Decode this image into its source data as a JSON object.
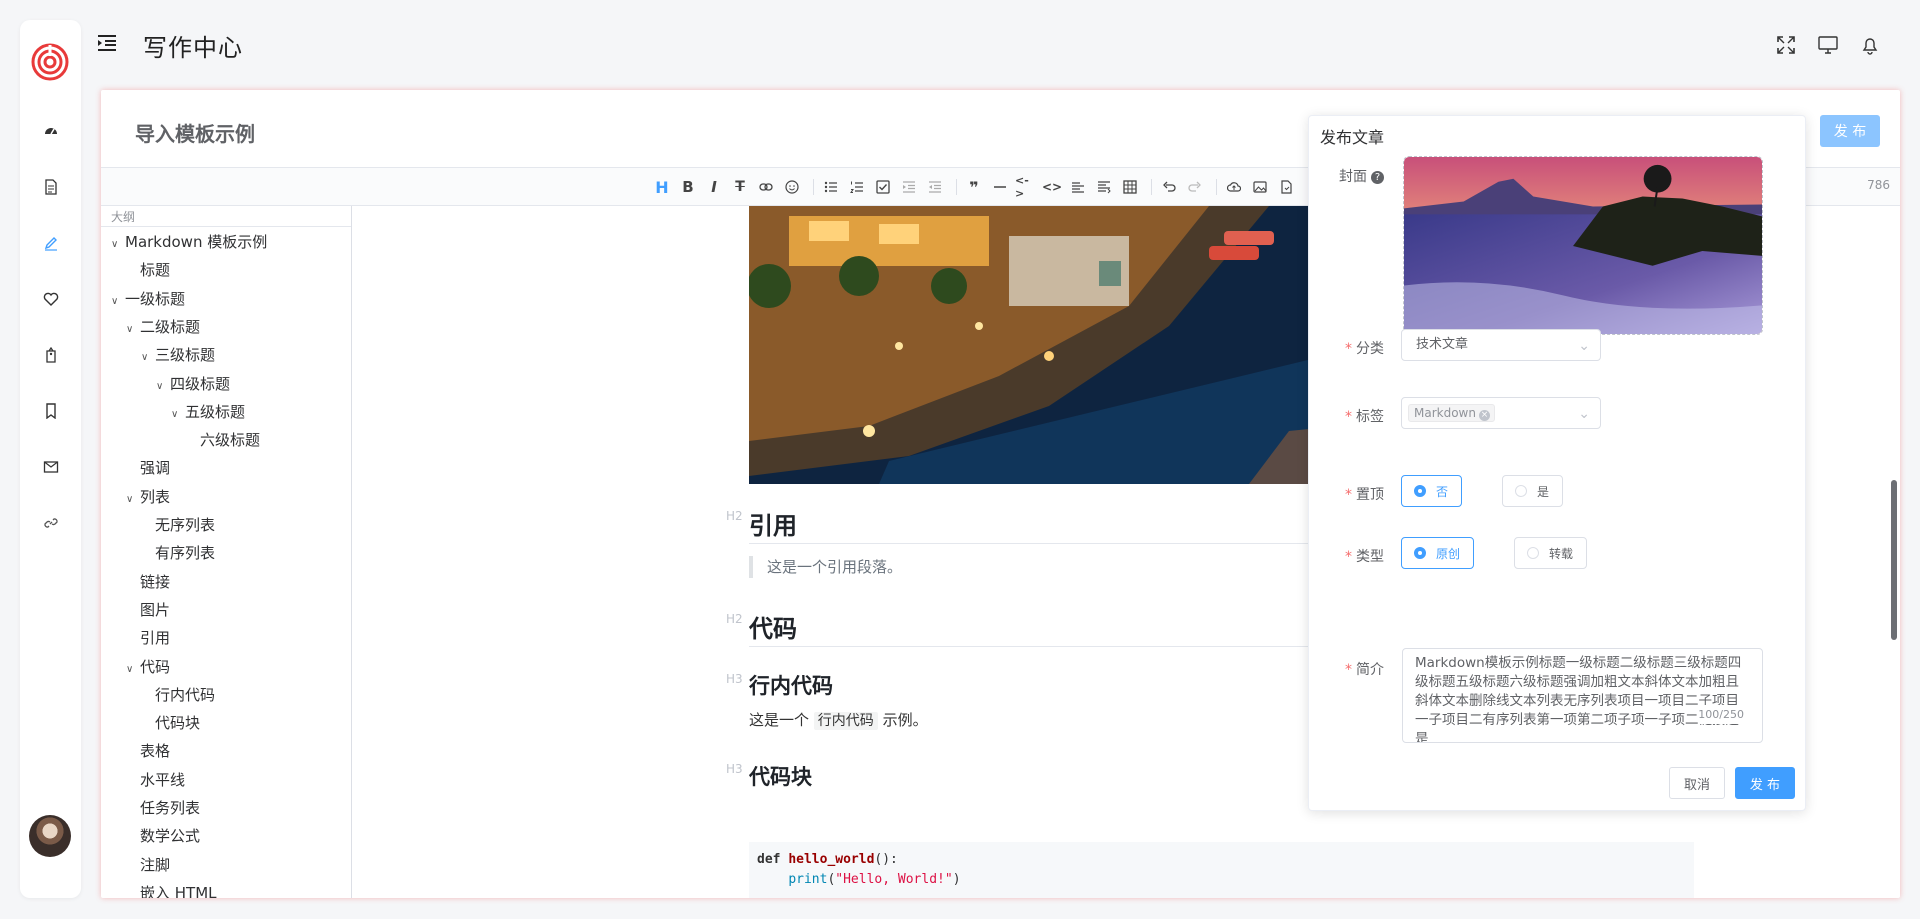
{
  "header": {
    "title": "写作中心"
  },
  "document": {
    "title": "导入模板示例",
    "publish_label": "发 布",
    "word_count": "786"
  },
  "outline": {
    "label": "大纲",
    "items": [
      {
        "label": "Markdown 模板示例",
        "level": 0,
        "caret": true
      },
      {
        "label": "标题",
        "level": 1,
        "caret": false
      },
      {
        "label": "一级标题",
        "level": 0,
        "caret": true
      },
      {
        "label": "二级标题",
        "level": 1,
        "caret": true
      },
      {
        "label": "三级标题",
        "level": 2,
        "caret": true
      },
      {
        "label": "四级标题",
        "level": 3,
        "caret": true
      },
      {
        "label": "五级标题",
        "level": 4,
        "caret": true
      },
      {
        "label": "六级标题",
        "level": 5,
        "caret": false
      },
      {
        "label": "强调",
        "level": 1,
        "caret": false
      },
      {
        "label": "列表",
        "level": 1,
        "caret": true
      },
      {
        "label": "无序列表",
        "level": 2,
        "caret": false
      },
      {
        "label": "有序列表",
        "level": 2,
        "caret": false
      },
      {
        "label": "链接",
        "level": 1,
        "caret": false
      },
      {
        "label": "图片",
        "level": 1,
        "caret": false
      },
      {
        "label": "引用",
        "level": 1,
        "caret": false
      },
      {
        "label": "代码",
        "level": 1,
        "caret": true
      },
      {
        "label": "行内代码",
        "level": 2,
        "caret": false
      },
      {
        "label": "代码块",
        "level": 2,
        "caret": false
      },
      {
        "label": "表格",
        "level": 1,
        "caret": false
      },
      {
        "label": "水平线",
        "level": 1,
        "caret": false
      },
      {
        "label": "任务列表",
        "level": 1,
        "caret": false
      },
      {
        "label": "数学公式",
        "level": 1,
        "caret": false
      },
      {
        "label": "注脚",
        "level": 1,
        "caret": false
      },
      {
        "label": "嵌入 HTML",
        "level": 1,
        "caret": false
      }
    ]
  },
  "content": {
    "h2_marker": "H2",
    "h3_marker": "H3",
    "quote_heading": "引用",
    "quote_text": "这是一个引用段落。",
    "code_heading": "代码",
    "inline_code_heading": "行内代码",
    "inline_before": "这是一个",
    "inline_code": "行内代码",
    "inline_after": "示例。",
    "code_block_heading": "代码块",
    "code_def": "def",
    "code_fn": "hello_world",
    "code_paren": "():",
    "code_print": "print",
    "code_open": "(",
    "code_str": "\"Hello, World!\"",
    "code_close": ")"
  },
  "dialog": {
    "title": "发布文章",
    "cover_label": "封面",
    "help": "?",
    "category_label": "分类",
    "category_value": "技术文章",
    "tags_label": "标签",
    "tag_value": "Markdown",
    "pin_label": "置顶",
    "pin_no": "否",
    "pin_yes": "是",
    "type_label": "类型",
    "type_original": "原创",
    "type_repost": "转载",
    "summary_label": "简介",
    "summary_value": "Markdown模板示例标题一级标题二级标题三级标题四级标题五级标题六级标题强调加粗文本斜体文本加粗且斜体文本删除线文本列表无序列表项目一项目二子项目一子项目二有序列表第一项第二项子项一子项二链接这是",
    "summary_counter": "100/250",
    "cancel_label": "取消",
    "publish_label": "发 布"
  },
  "colors": {
    "accent": "#409eff",
    "required": "#f56c6c",
    "logo": "#e83a3a"
  }
}
